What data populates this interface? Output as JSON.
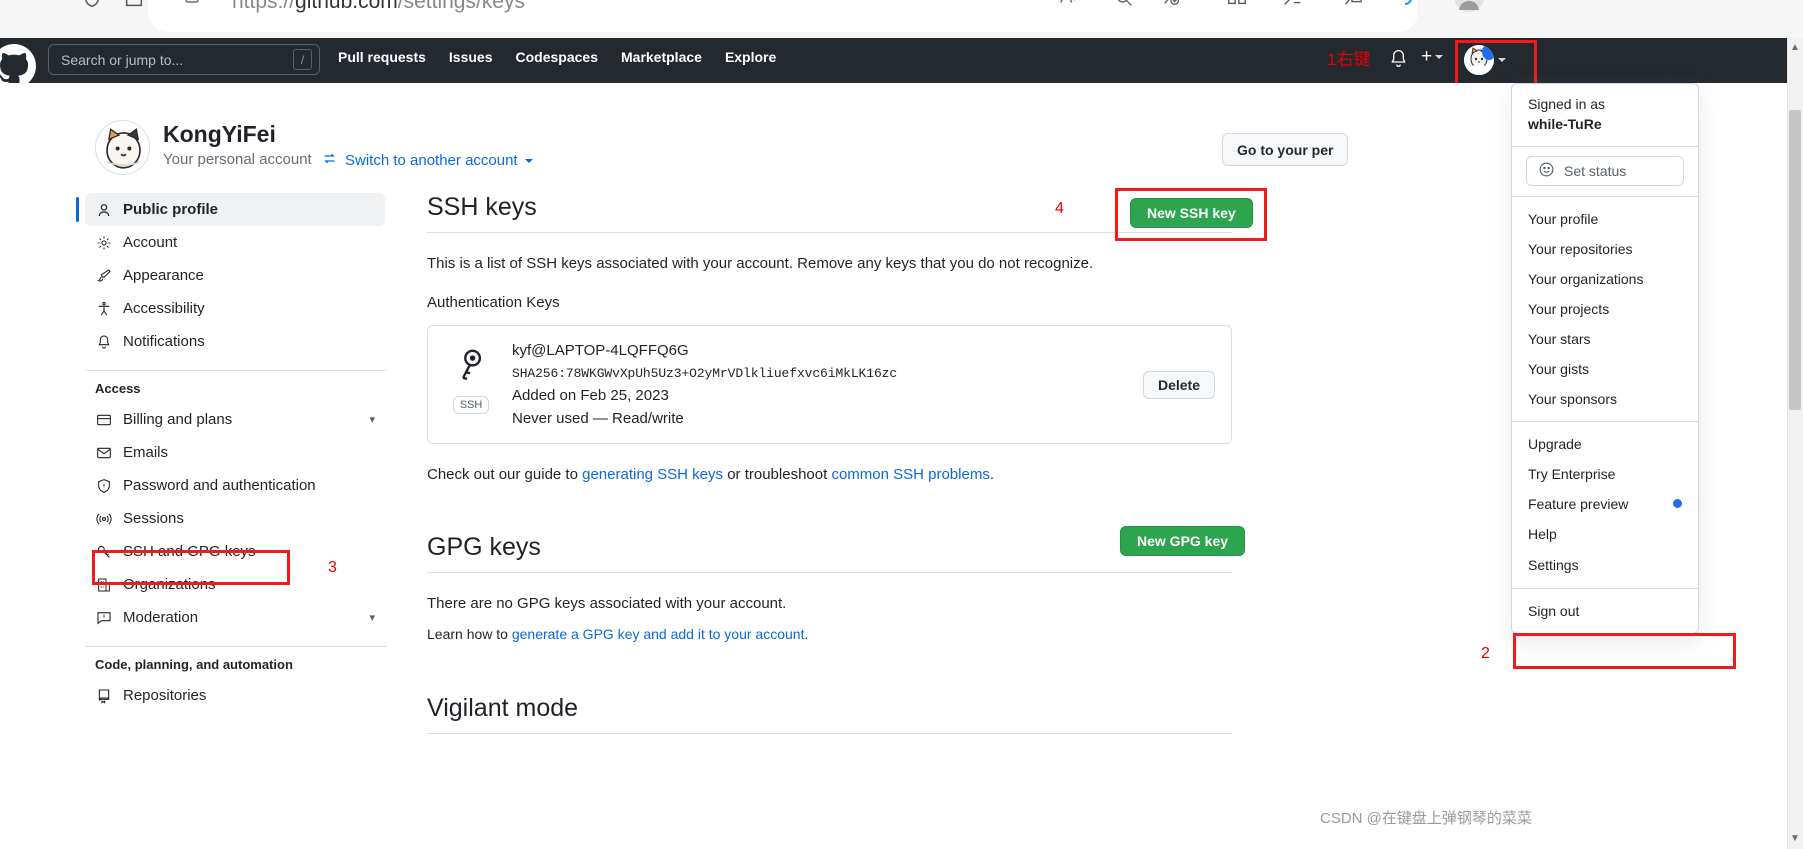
{
  "browser": {
    "url_prefix": "https://",
    "url_domain": "github.com",
    "url_path": "/settings/keys",
    "icons": [
      "shield-icon",
      "home-icon",
      "page-info-icon",
      "read-aloud-icon",
      "find-icon",
      "collections-icon",
      "split-screen-icon",
      "favorites-icon",
      "add-tab-icon",
      "browser-essentials-icon",
      "profile-icon",
      "settings-more-icon"
    ]
  },
  "gh_header": {
    "search_placeholder": "Search or jump to...",
    "search_shortcut": "/",
    "nav": [
      {
        "label": "Pull requests"
      },
      {
        "label": "Issues"
      },
      {
        "label": "Codespaces"
      },
      {
        "label": "Marketplace"
      },
      {
        "label": "Explore"
      }
    ],
    "annotation_1": "1右键"
  },
  "account": {
    "name": "KongYiFei",
    "subtitle": "Your personal account",
    "switch_label": "Switch to another account",
    "goto_button": "Go to your per"
  },
  "sidebar": {
    "items": [
      {
        "label": "Public profile",
        "icon": "person-icon",
        "active": true
      },
      {
        "label": "Account",
        "icon": "gear-icon",
        "active": false
      },
      {
        "label": "Appearance",
        "icon": "paintbrush-icon",
        "active": false
      },
      {
        "label": "Accessibility",
        "icon": "accessibility-icon",
        "active": false
      },
      {
        "label": "Notifications",
        "icon": "bell-icon",
        "active": false
      }
    ],
    "access_header": "Access",
    "access_items": [
      {
        "label": "Billing and plans",
        "icon": "credit-card-icon",
        "chevron": true
      },
      {
        "label": "Emails",
        "icon": "mail-icon",
        "chevron": false
      },
      {
        "label": "Password and authentication",
        "icon": "shield-lock-icon",
        "chevron": false
      },
      {
        "label": "Sessions",
        "icon": "broadcast-icon",
        "chevron": false
      },
      {
        "label": "SSH and GPG keys",
        "icon": "key-icon",
        "chevron": false
      },
      {
        "label": "Organizations",
        "icon": "organization-icon",
        "chevron": false
      },
      {
        "label": "Moderation",
        "icon": "report-icon",
        "chevron": true
      }
    ],
    "code_header": "Code, planning, and automation",
    "code_items": [
      {
        "label": "Repositories",
        "icon": "repo-icon",
        "chevron": false
      }
    ],
    "annotation_3": "3"
  },
  "ssh_section": {
    "title": "SSH keys",
    "new_key_button": "New SSH key",
    "annotation_4": "4",
    "description": "This is a list of SSH keys associated with your account. Remove any keys that you do not recognize.",
    "auth_keys_header": "Authentication Keys",
    "key": {
      "title": "kyf@LAPTOP-4LQFFQ6G",
      "fingerprint": "SHA256:78WKGWvXpUh5Uz3+O2yMrVDlkliuefxvc6iMkLK16zc",
      "added": "Added on Feb 25, 2023",
      "usage": "Never used — Read/write",
      "chip": "SSH",
      "delete_button": "Delete"
    },
    "guide_pre": "Check out our guide to ",
    "guide_link1": "generating SSH keys",
    "guide_mid": " or troubleshoot ",
    "guide_link2": "common SSH problems",
    "guide_post": "."
  },
  "gpg_section": {
    "title": "GPG keys",
    "new_key_button": "New GPG key",
    "empty_text": "There are no GPG keys associated with your account.",
    "learn_pre": "Learn how to ",
    "learn_link": "generate a GPG key and add it to your account",
    "learn_post": "."
  },
  "vigilant_section": {
    "title": "Vigilant mode"
  },
  "dropdown": {
    "signed_in_label": "Signed in as",
    "username": "while-TuRe",
    "set_status": "Set status",
    "group1": [
      {
        "label": "Your profile"
      },
      {
        "label": "Your repositories"
      },
      {
        "label": "Your organizations"
      },
      {
        "label": "Your projects"
      },
      {
        "label": "Your stars"
      },
      {
        "label": "Your gists"
      },
      {
        "label": "Your sponsors"
      }
    ],
    "group2": [
      {
        "label": "Upgrade",
        "dot": false
      },
      {
        "label": "Try Enterprise",
        "dot": false
      },
      {
        "label": "Feature preview",
        "dot": true
      },
      {
        "label": "Help",
        "dot": false
      },
      {
        "label": "Settings",
        "dot": false
      }
    ],
    "group3": [
      {
        "label": "Sign out"
      }
    ],
    "annotation_2": "2"
  },
  "watermark": "CSDN @在键盘上弹钢琴的菜菜",
  "colors": {
    "green": "#2da44e",
    "link": "#0969da",
    "header_bg": "#24292f",
    "annotation_red": "#f21b1b"
  }
}
